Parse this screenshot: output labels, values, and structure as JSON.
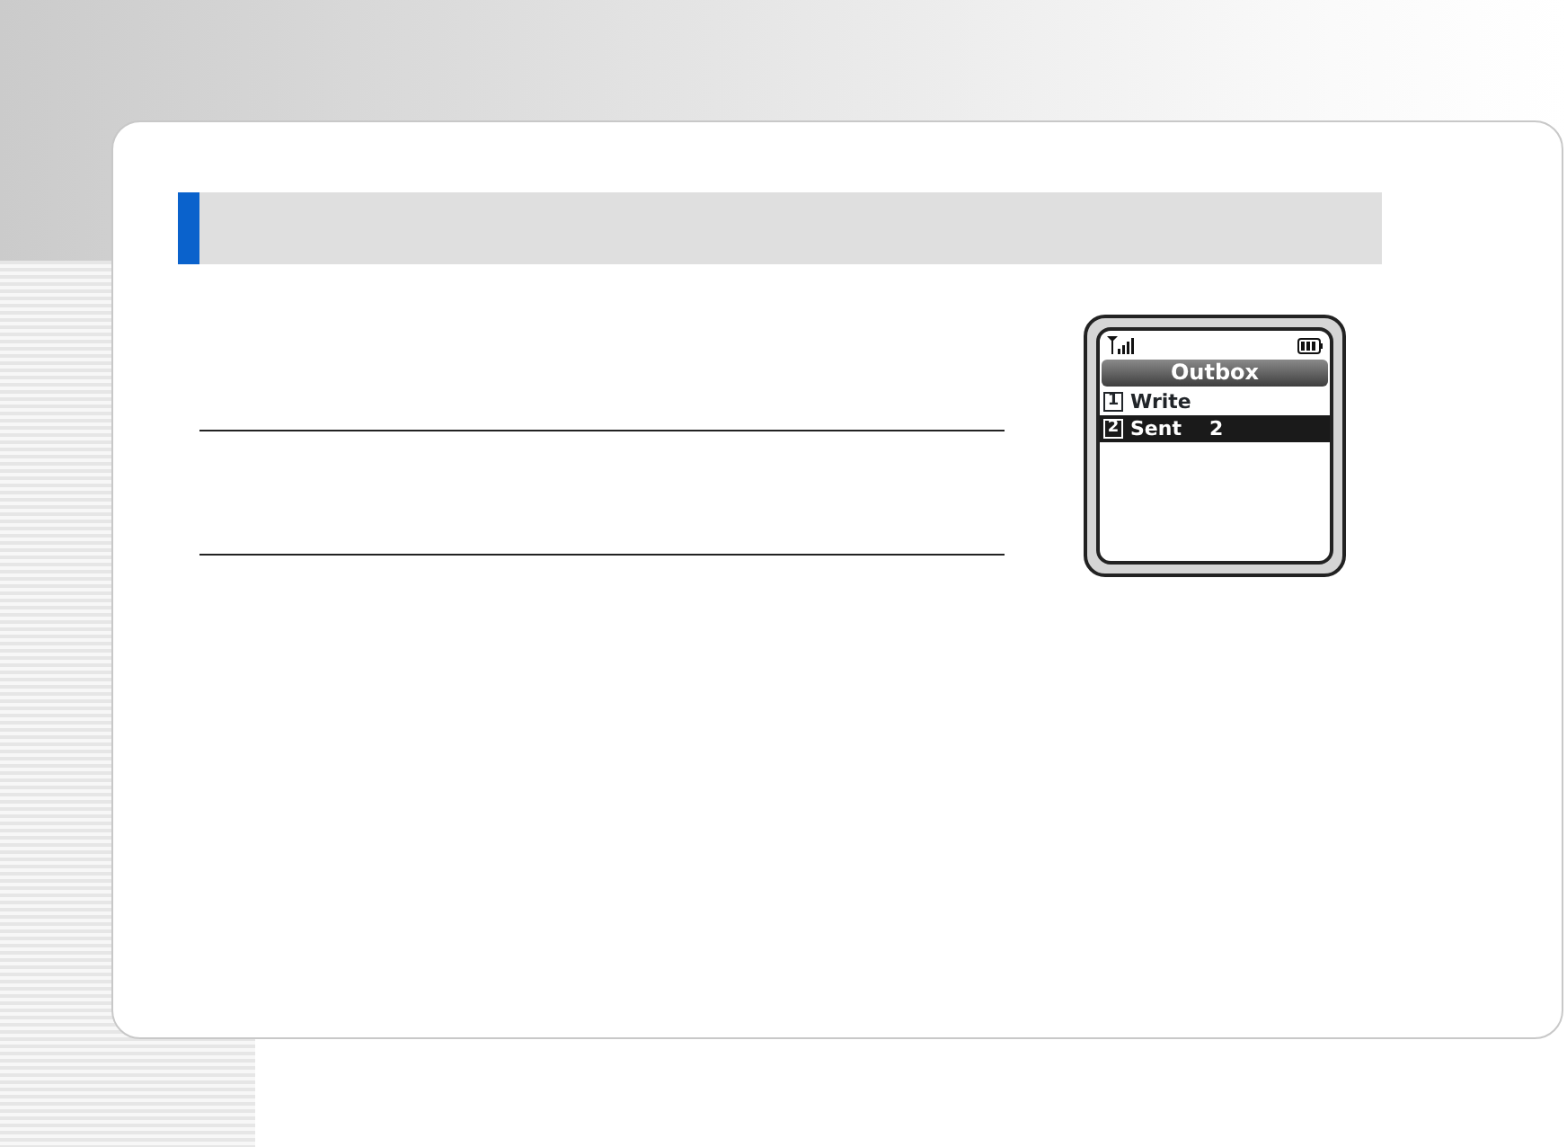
{
  "phone_screen": {
    "title": "Outbox",
    "items": [
      {
        "number": "1",
        "label": "Write",
        "selected": false
      },
      {
        "number": "2",
        "label": "Sent",
        "count": "2",
        "selected": true
      }
    ]
  }
}
